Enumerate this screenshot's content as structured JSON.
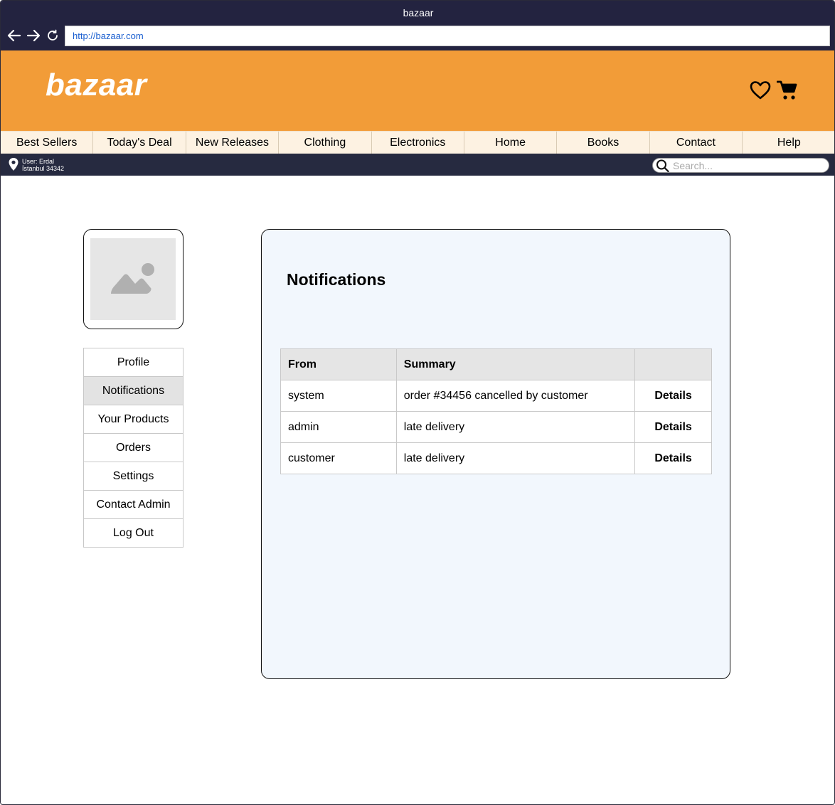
{
  "browser": {
    "window_title": "bazaar",
    "url": "http://bazaar.com"
  },
  "header": {
    "logo": "bazaar",
    "icons": [
      "heart-icon",
      "cart-icon"
    ]
  },
  "categories": [
    {
      "label": "Best Sellers"
    },
    {
      "label": "Today's Deal"
    },
    {
      "label": "New Releases"
    },
    {
      "label": "Clothing"
    },
    {
      "label": "Electronics"
    },
    {
      "label": "Home"
    },
    {
      "label": "Books"
    },
    {
      "label": "Contact"
    },
    {
      "label": "Help"
    }
  ],
  "userbar": {
    "user_line": "User: Erdal",
    "location_line": "İstanbul 34342",
    "search_placeholder": "Search..."
  },
  "sidebar": {
    "items": [
      {
        "label": "Profile"
      },
      {
        "label": "Notifications",
        "active": true
      },
      {
        "label": "Your Products"
      },
      {
        "label": "Orders"
      },
      {
        "label": "Settings"
      },
      {
        "label": "Contact Admin"
      },
      {
        "label": "Log Out"
      }
    ]
  },
  "main": {
    "title": "Notifications",
    "table": {
      "headers": [
        "From",
        "Summary",
        ""
      ],
      "rows": [
        {
          "from": "system",
          "summary": "order #34456 cancelled by customer",
          "action": "Details"
        },
        {
          "from": "admin",
          "summary": "late delivery",
          "action": "Details"
        },
        {
          "from": "customer",
          "summary": "late delivery",
          "action": "Details"
        }
      ]
    }
  },
  "colors": {
    "chrome": "#232340",
    "header": "#f29c38",
    "nav_bg": "#fdf2e2",
    "userbar": "#262a40",
    "panel_bg": "#f2f7fd"
  }
}
